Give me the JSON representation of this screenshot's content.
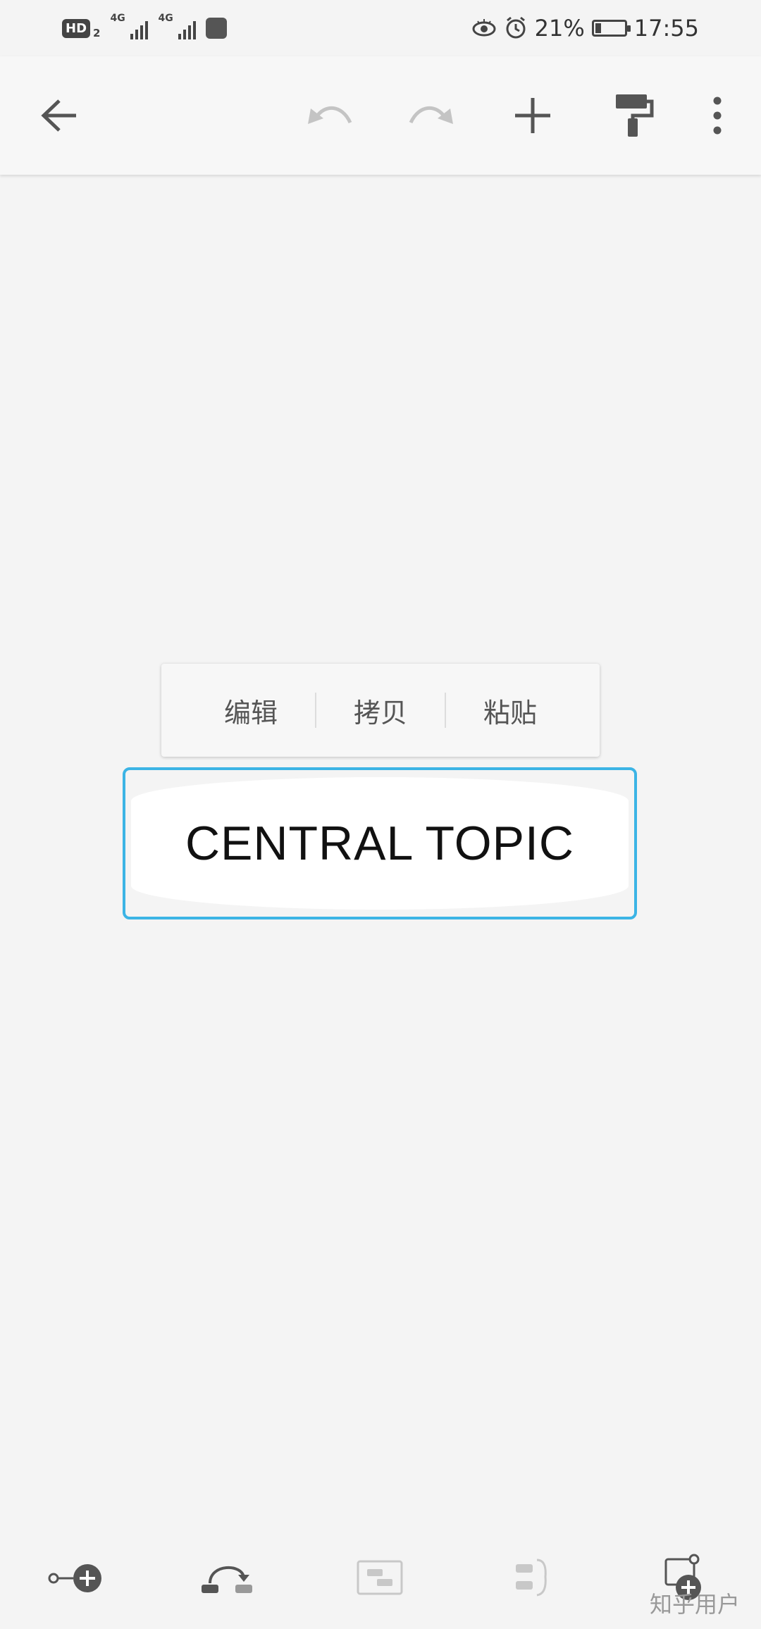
{
  "status_bar": {
    "hd_label": "HD",
    "hd_sub": "2",
    "network_1": "4G",
    "network_2": "4G",
    "battery_percent": "21%",
    "battery_level": 0.21,
    "time": "17:55",
    "icons": [
      "eye-icon",
      "alarm-icon",
      "battery-icon"
    ]
  },
  "toolbar": {
    "icons": [
      "back-arrow-icon",
      "undo-icon",
      "redo-icon",
      "add-icon",
      "format-painter-icon",
      "more-vert-icon"
    ],
    "undo_enabled": false,
    "redo_enabled": false
  },
  "context_menu": {
    "items": [
      {
        "label": "编辑"
      },
      {
        "label": "拷贝"
      },
      {
        "label": "粘贴"
      }
    ]
  },
  "topic": {
    "text": "CENTRAL TOPIC",
    "selection_color": "#3cb4e5"
  },
  "bottom_bar": {
    "icons": [
      "add-subtopic-icon",
      "relationship-icon",
      "boundary-icon",
      "summary-icon",
      "add-floating-topic-icon"
    ]
  },
  "watermark": "知乎用户"
}
